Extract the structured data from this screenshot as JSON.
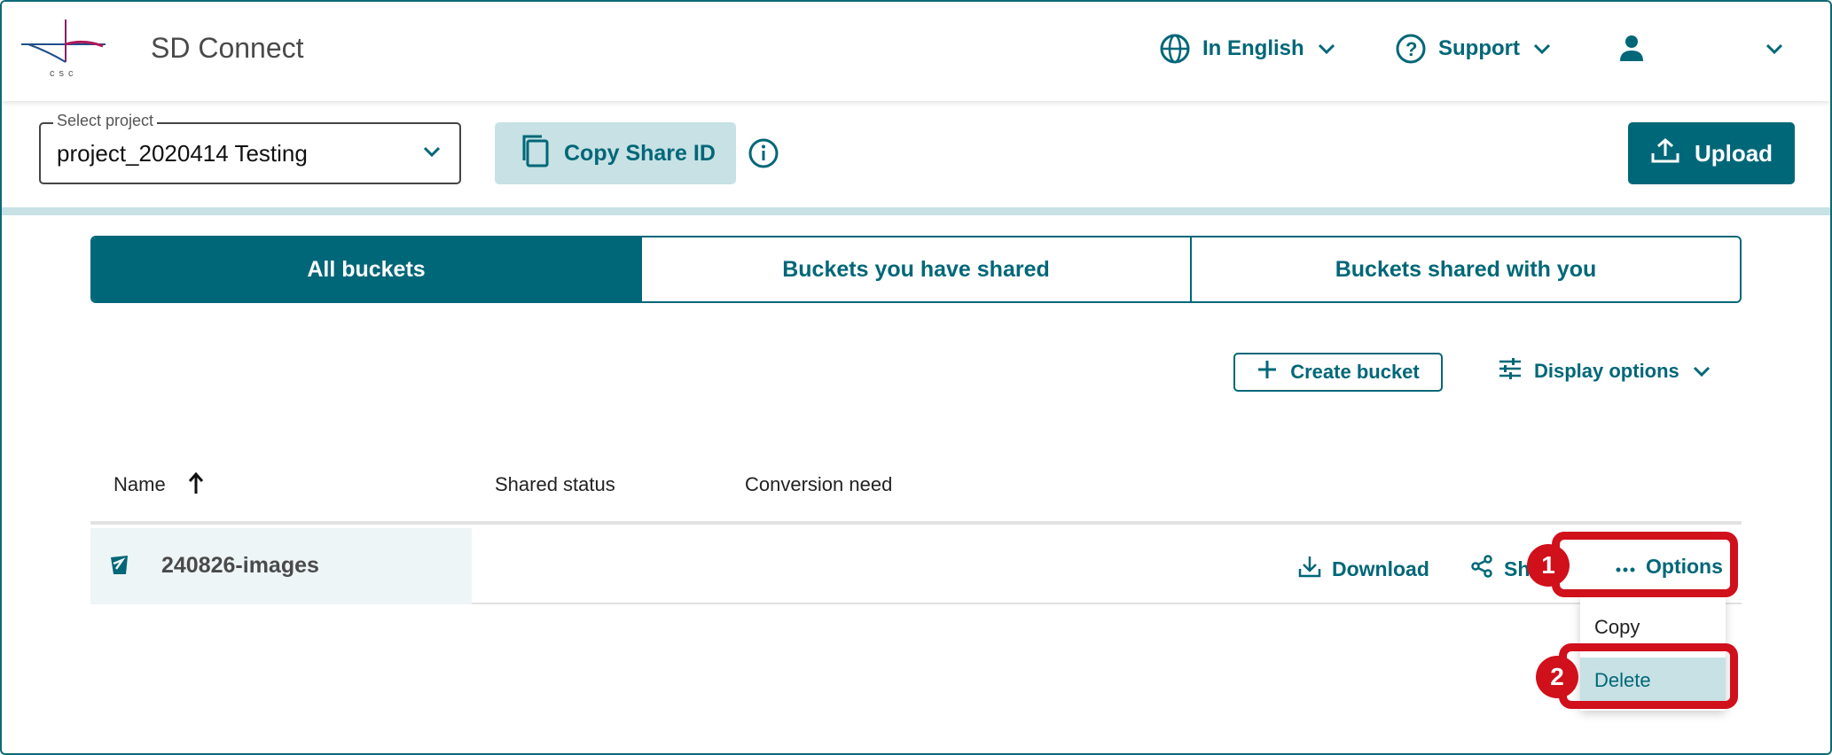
{
  "header": {
    "logo_text": "csc",
    "app_title": "SD Connect",
    "language_label": "In English",
    "support_label": "Support"
  },
  "toolbar": {
    "project_legend": "Select project",
    "project_value": "project_2020414 Testing",
    "copy_share_label": "Copy Share ID",
    "upload_label": "Upload"
  },
  "tabs": [
    {
      "label": "All buckets",
      "active": true
    },
    {
      "label": "Buckets you have shared",
      "active": false
    },
    {
      "label": "Buckets shared with you",
      "active": false
    }
  ],
  "actions": {
    "create_bucket_label": "Create bucket",
    "display_options_label": "Display options"
  },
  "table": {
    "columns": [
      "Name",
      "Shared status",
      "Conversion need"
    ],
    "rows": [
      {
        "name": "240826-images",
        "download_label": "Download",
        "share_label": "Sh",
        "options_label": "Options"
      }
    ]
  },
  "options_menu": {
    "items": [
      "Copy",
      "Delete"
    ],
    "highlighted": "Delete"
  },
  "callouts": [
    "1",
    "2"
  ],
  "colors": {
    "accent": "#006778",
    "accent_light": "#c7e1e5",
    "callout_red": "#d0101b"
  }
}
